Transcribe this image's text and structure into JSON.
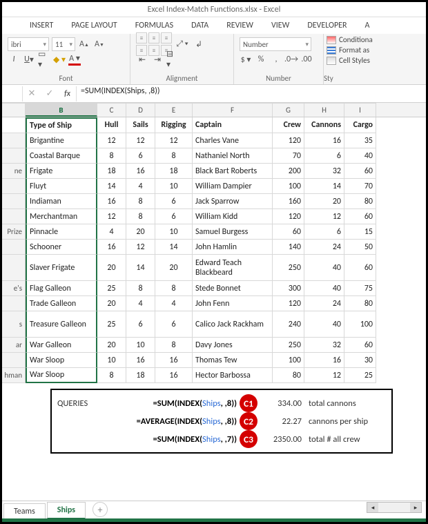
{
  "title": "Excel Index-Match Functions.xlsx - Excel",
  "ribbon_tabs": [
    "INSERT",
    "PAGE LAYOUT",
    "FORMULAS",
    "DATA",
    "REVIEW",
    "VIEW",
    "DEVELOPER",
    "A"
  ],
  "font": {
    "name": "ibri",
    "size": "11"
  },
  "number_format": "Number",
  "groups": {
    "font": "Font",
    "alignment": "Alignment",
    "number": "Number",
    "styles": "Sty"
  },
  "styles": {
    "cond": "Conditiona",
    "fmt": "Format as",
    "cell": "Cell Styles "
  },
  "formula": "=SUM(INDEX(Ships, ,8))",
  "columns": [
    "",
    "B",
    "C",
    "D",
    "E",
    "F",
    "G",
    "H",
    "I"
  ],
  "headers": {
    "type": "Type of Ship",
    "hull": "Hull",
    "sails": "Sails",
    "rigging": "Rigging",
    "captain": "Captain",
    "crew": "Crew",
    "cannons": "Cannons",
    "cargo": "Cargo"
  },
  "rowlabels": [
    "",
    "",
    "",
    "ne",
    "",
    "",
    "",
    "Prize",
    "",
    "",
    "e's",
    "",
    "s",
    "ar",
    "",
    "hman",
    "",
    ""
  ],
  "rows": [
    {
      "type": "Brigantine",
      "hull": 12,
      "sails": 12,
      "rigging": 12,
      "captain": "Charles Vane",
      "crew": 120,
      "cannons": 16,
      "cargo": 35
    },
    {
      "type": "Coastal Barque",
      "hull": 8,
      "sails": 6,
      "rigging": 8,
      "captain": "Nathaniel North",
      "crew": 70,
      "cannons": 6,
      "cargo": 40
    },
    {
      "type": "Frigate",
      "hull": 18,
      "sails": 16,
      "rigging": 18,
      "captain": "Black Bart Roberts",
      "crew": 200,
      "cannons": 32,
      "cargo": 60
    },
    {
      "type": "Fluyt",
      "hull": 14,
      "sails": 4,
      "rigging": 10,
      "captain": "William Dampier",
      "crew": 100,
      "cannons": 14,
      "cargo": 70
    },
    {
      "type": "Indiaman",
      "hull": 16,
      "sails": 8,
      "rigging": 6,
      "captain": "Jack Sparrow",
      "crew": 160,
      "cannons": 20,
      "cargo": 80
    },
    {
      "type": "Merchantman",
      "hull": 12,
      "sails": 8,
      "rigging": 6,
      "captain": "William Kidd",
      "crew": 120,
      "cannons": 12,
      "cargo": 60
    },
    {
      "type": "Pinnacle",
      "hull": 4,
      "sails": 20,
      "rigging": 10,
      "captain": "Samuel Burgess",
      "crew": 60,
      "cannons": 6,
      "cargo": 15
    },
    {
      "type": "Schooner",
      "hull": 16,
      "sails": 12,
      "rigging": 14,
      "captain": "John Hamlin",
      "crew": 140,
      "cannons": 24,
      "cargo": 50
    },
    {
      "type": "Slaver Frigate",
      "hull": 20,
      "sails": 14,
      "rigging": 20,
      "captain": "Edward Teach Blackbeard",
      "crew": 250,
      "cannons": 40,
      "cargo": 60,
      "tall": true
    },
    {
      "type": "Flag Galleon",
      "hull": 25,
      "sails": 8,
      "rigging": 8,
      "captain": "Stede Bonnet",
      "crew": 300,
      "cannons": 40,
      "cargo": 75
    },
    {
      "type": "Trade Galleon",
      "hull": 20,
      "sails": 4,
      "rigging": 4,
      "captain": "John Fenn",
      "crew": 120,
      "cannons": 24,
      "cargo": 80
    },
    {
      "type": "Treasure Galleon",
      "hull": 25,
      "sails": 6,
      "rigging": 6,
      "captain": "Calico Jack Rackham",
      "crew": 240,
      "cannons": 40,
      "cargo": 100,
      "tall": true
    },
    {
      "type": "War Galleon",
      "hull": 20,
      "sails": 10,
      "rigging": 8,
      "captain": "Davy Jones",
      "crew": 250,
      "cannons": 32,
      "cargo": 60
    },
    {
      "type": "War Sloop",
      "hull": 10,
      "sails": 16,
      "rigging": 16,
      "captain": "Thomas Tew",
      "crew": 100,
      "cannons": 16,
      "cargo": 30
    },
    {
      "type": "War Sloop",
      "hull": 8,
      "sails": 18,
      "rigging": 16,
      "captain": "Hector Barbossa",
      "crew": 80,
      "cannons": 12,
      "cargo": 25
    }
  ],
  "queries": {
    "label": "QUERIES",
    "items": [
      {
        "badge": "C1",
        "formula_pre": "=SUM(INDEX(",
        "formula_ref": "Ships",
        "formula_post": ", ,8))",
        "value": "334.00",
        "desc": "total cannons"
      },
      {
        "badge": "C2",
        "formula_pre": "=AVERAGE(INDEX(",
        "formula_ref": "Ships",
        "formula_post": ", ,8))",
        "value": "22.27",
        "desc": "cannons per ship"
      },
      {
        "badge": "C3",
        "formula_pre": "=SUM(INDEX(",
        "formula_ref": "Ships",
        "formula_post": ", ,7))",
        "value": "2350.00",
        "desc": "total # all crew"
      }
    ]
  },
  "sheets": [
    "Teams",
    "Ships"
  ],
  "active_sheet": "Ships"
}
